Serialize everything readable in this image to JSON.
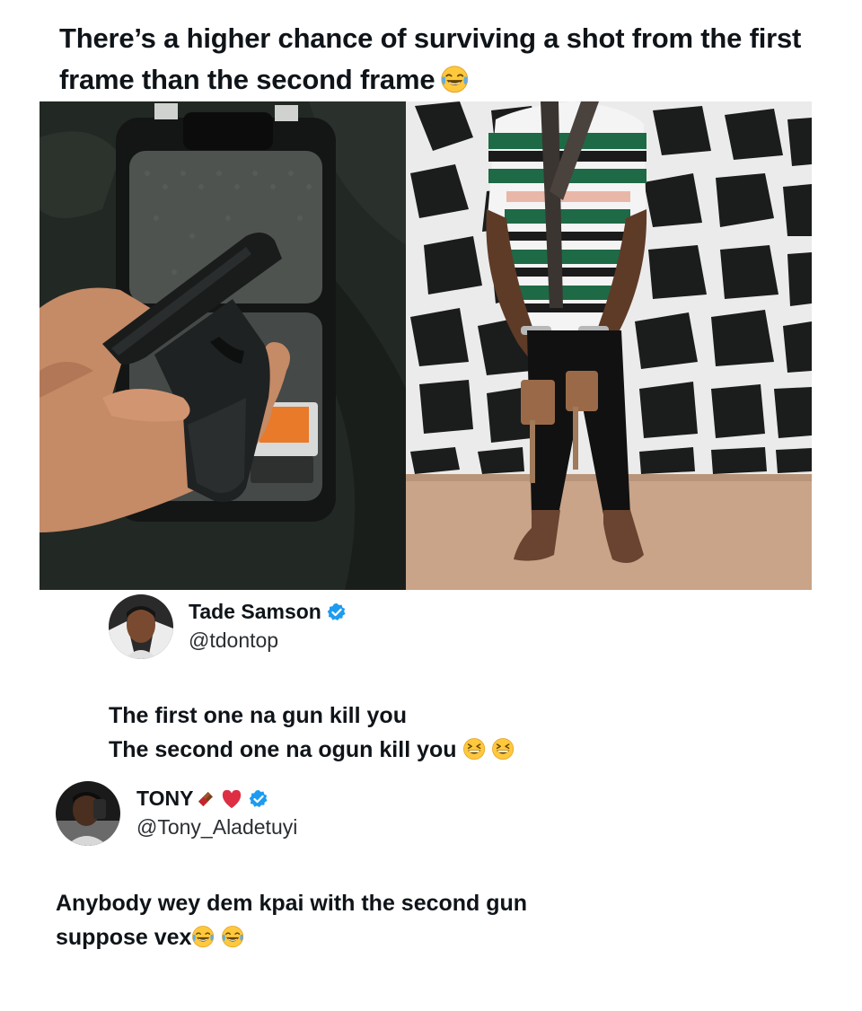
{
  "post": {
    "headline": "There’s a higher chance of surviving a shot from the first frame than the second frame",
    "headline_emoji": "face-with-tears-of-joy-icon"
  },
  "images": {
    "left": "photo of a hand holding a black handgun over an open foam-lined gun case",
    "right": "photo of a handcuffed man in a striped shirt standing barefoot before a stone wall with charms tied at his waist"
  },
  "replies": [
    {
      "name": "Tade Samson",
      "handle": "@tdontop",
      "verified": true,
      "lines": [
        "The first one na gun kill you",
        "The second one na ogun kill you"
      ],
      "line_emoji": [
        "grinning-squinting-face-icon",
        "grinning-squinting-face-icon"
      ]
    },
    {
      "name": "TONY",
      "name_emoji": [
        "chocolate-bar-icon",
        "red-heart-icon"
      ],
      "handle": "@Tony_Aladetuyi",
      "verified": true,
      "lines": [
        "Anybody wey dem kpai with the second gun",
        "suppose vex"
      ],
      "line_emoji": [
        "face-with-tears-of-joy-icon",
        "face-with-tears-of-joy-icon"
      ]
    }
  ],
  "colors": {
    "verified_badge": "#1d9bf0",
    "text": "#0f1419",
    "emoji_yellow": "#ffc83d"
  }
}
